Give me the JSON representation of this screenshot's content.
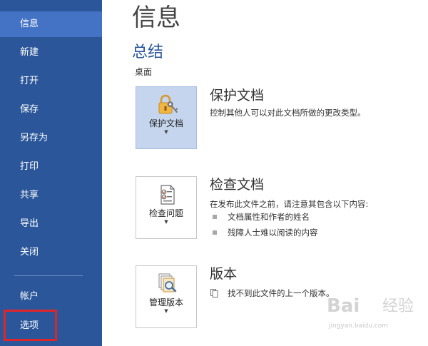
{
  "sidebar": {
    "items": [
      {
        "label": "信息",
        "active": true
      },
      {
        "label": "新建"
      },
      {
        "label": "打开"
      },
      {
        "label": "保存"
      },
      {
        "label": "另存为"
      },
      {
        "label": "打印"
      },
      {
        "label": "共享"
      },
      {
        "label": "导出"
      },
      {
        "label": "关闭"
      }
    ],
    "account_label": "帐户",
    "options_label": "选项"
  },
  "main": {
    "title": "信息",
    "section_title": "总结",
    "location": "桌面",
    "cards": [
      {
        "tile_label": "保护文档",
        "title": "保护文档",
        "description": "控制其他人可以对此文档所做的更改类型。",
        "icon": "lock-key-icon"
      },
      {
        "tile_label": "检查问题",
        "title": "检查文档",
        "description": "在发布此文件之前，请注意其包含以下内容:",
        "bullets": [
          "文档属性和作者的姓名",
          "残障人士难以阅读的内容"
        ],
        "icon": "document-checklist-icon"
      },
      {
        "tile_label": "管理版本",
        "title": "版本",
        "description": "找不到此文件的上一个版本。",
        "icon": "version-magnifier-icon"
      }
    ]
  },
  "watermark": {
    "brand": "Bai",
    "brand2": "经验",
    "url": "jingyan.baidu.com"
  },
  "colors": {
    "sidebar_bg": "#2b579a",
    "sidebar_active": "#4472c4",
    "highlight_border": "#e0252a",
    "accent_text": "#2b579a"
  }
}
